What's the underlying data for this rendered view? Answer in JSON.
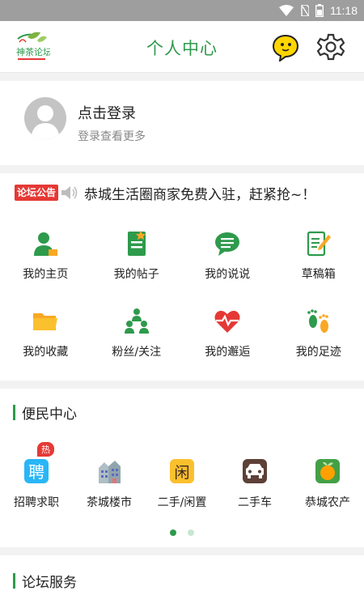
{
  "status_bar": {
    "time": "11:18"
  },
  "header": {
    "title": "个人中心",
    "logo_text": "神茶论坛"
  },
  "login": {
    "title": "点击登录",
    "subtitle": "登录查看更多"
  },
  "notice": {
    "badge": "论坛公告",
    "text": "恭城生活圈商家免费入驻，赶紧抢~！"
  },
  "menu": {
    "row1": [
      {
        "label": "我的主页",
        "icon": "user-home-icon"
      },
      {
        "label": "我的帖子",
        "icon": "document-icon"
      },
      {
        "label": "我的说说",
        "icon": "chat-bubble-icon"
      },
      {
        "label": "草稿箱",
        "icon": "draft-pen-icon"
      }
    ],
    "row2": [
      {
        "label": "我的收藏",
        "icon": "folder-icon"
      },
      {
        "label": "粉丝/关注",
        "icon": "people-icon"
      },
      {
        "label": "我的邂逅",
        "icon": "heart-pulse-icon"
      },
      {
        "label": "我的足迹",
        "icon": "footprint-icon"
      }
    ]
  },
  "convenience": {
    "title": "便民中心",
    "items": [
      {
        "label": "招聘求职",
        "icon": "recruit-icon",
        "badge": "热"
      },
      {
        "label": "茶城楼市",
        "icon": "building-icon"
      },
      {
        "label": "二手/闲置",
        "icon": "idle-icon",
        "glyph": "闲"
      },
      {
        "label": "二手车",
        "icon": "car-icon"
      },
      {
        "label": "恭城农产",
        "icon": "produce-icon"
      }
    ],
    "recruit_glyph": "聘"
  },
  "forum_services": {
    "title": "论坛服务"
  },
  "colors": {
    "accent": "#2e9a4c",
    "badge": "#e53935"
  }
}
